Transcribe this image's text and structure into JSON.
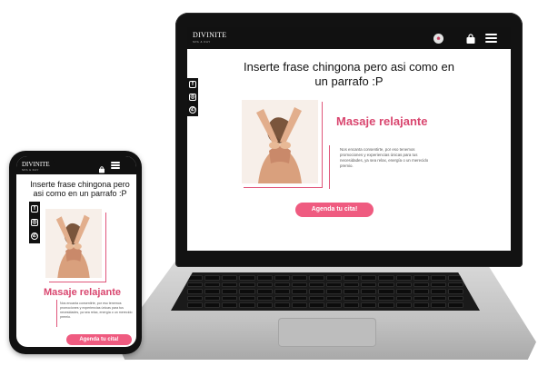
{
  "brand": {
    "logo": "DIVINITE",
    "tagline": "SPA & DAY",
    "accent_color": "#d9466f",
    "button_color": "#ef5b80",
    "nav_color": "#111111"
  },
  "nav": {
    "profile_icon": "user-avatar-icon",
    "cart_icon": "shopping-bag-icon",
    "menu_icon": "hamburger-menu-icon"
  },
  "hero": {
    "title": "Inserte frase chingona pero asi como en un parrafo :P"
  },
  "social": [
    {
      "name": "facebook-icon",
      "glyph": "f"
    },
    {
      "name": "instagram-icon",
      "glyph": "◎"
    },
    {
      "name": "whatsapp-icon",
      "glyph": "✆"
    }
  ],
  "service": {
    "heading": "Masaje relajante",
    "description": "Nos encanta consentirte, por eso tenemos promociones y experiencias únicas para tus necesidades, ya sea relax, energía o un merecido premio.",
    "image": "massage-photo"
  },
  "cta": {
    "label": "Agenda tu cita!"
  }
}
